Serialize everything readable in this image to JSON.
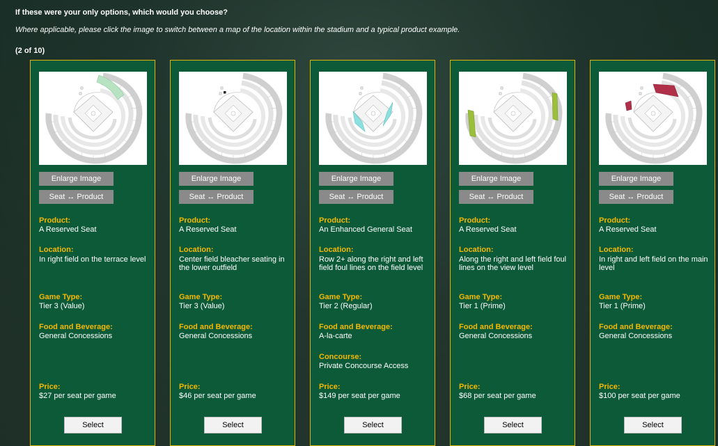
{
  "question": {
    "title": "If these were your only options, which would you choose?",
    "instructions": "Where applicable, please click the image to switch between a map of the location within the stadium and a typical product example.",
    "counter": "(2 of 10)"
  },
  "buttons": {
    "enlarge": "Enlarge Image",
    "swap": "Seat ↔ Product",
    "select": "Select"
  },
  "labels": {
    "product": "Product:",
    "location": "Location:",
    "game_type": "Game Type:",
    "food": "Food and Beverage:",
    "concourse": "Concourse:",
    "price": "Price:"
  },
  "colors": {
    "card_bg": "#0c5a38",
    "card_border": "#e2b400",
    "label": "#f5b800",
    "highlight_terrace_right": "#b7e3c2",
    "highlight_field_foul": "#8de0e0",
    "highlight_view_foul": "#9bbf3a",
    "highlight_main": "#b0304a"
  },
  "options": [
    {
      "product": "A Reserved Seat",
      "location": "In right field on the terrace level",
      "game_type": "Tier 3 (Value)",
      "food": "General Concessions",
      "concourse": "",
      "price": "$27 per seat per game",
      "highlight": "terrace-right"
    },
    {
      "product": "A Reserved Seat",
      "location": "Center field bleacher seating in the lower outfield",
      "game_type": "Tier 3 (Value)",
      "food": "General Concessions",
      "concourse": "",
      "price": "$46 per seat per game",
      "highlight": "bleacher-center"
    },
    {
      "product": "An Enhanced General Seat",
      "location": "Row 2+ along the right and left field foul lines on the field level",
      "game_type": "Tier 2 (Regular)",
      "food": "A-la-carte",
      "concourse": "Private Concourse Access",
      "price": "$149 per seat per game",
      "highlight": "field-foul"
    },
    {
      "product": "A Reserved Seat",
      "location": "Along the right and left field foul lines on the view level",
      "game_type": "Tier 1 (Prime)",
      "food": "General Concessions",
      "concourse": "",
      "price": "$68 per seat per game",
      "highlight": "view-foul"
    },
    {
      "product": "A Reserved Seat",
      "location": "In right and left field on the main level",
      "game_type": "Tier 1 (Prime)",
      "food": "General Concessions",
      "concourse": "",
      "price": "$100 per seat per game",
      "highlight": "main-outfield"
    }
  ]
}
